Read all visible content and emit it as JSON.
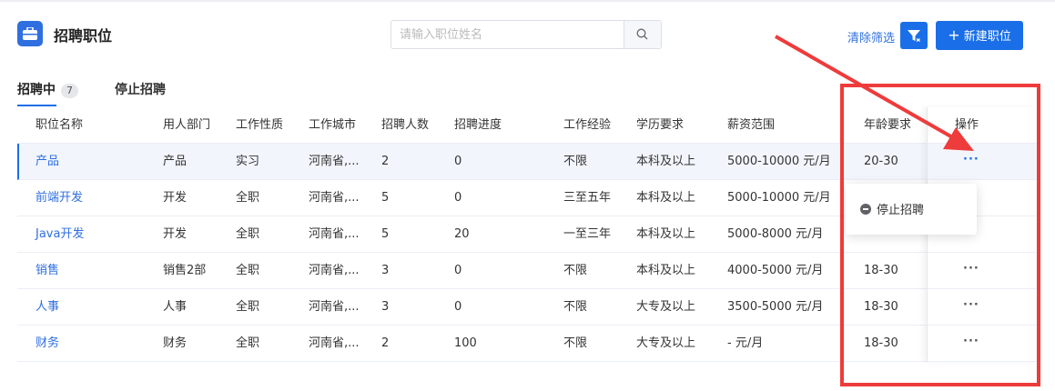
{
  "header": {
    "title": "招聘职位",
    "title_icon": "briefcase-icon",
    "search_placeholder": "请输入职位姓名",
    "search_icon": "search-icon",
    "clear_filters": "清除筛选",
    "filter_icon": "filter-clear-icon",
    "new_button": "新建职位",
    "new_button_icon": "plus-icon"
  },
  "tabs": {
    "recruiting": "招聘中",
    "recruiting_count": "7",
    "stopped": "停止招聘"
  },
  "table": {
    "columns": [
      "职位名称",
      "用人部门",
      "工作性质",
      "工作城市",
      "招聘人数",
      "招聘进度",
      "工作经验",
      "学历要求",
      "薪资范围",
      "年龄要求",
      "操作"
    ],
    "rows": [
      {
        "name": "产品",
        "dept": "产品",
        "type": "实习",
        "city": "河南省,...",
        "count": "2",
        "progress": "0",
        "exp": "不限",
        "edu": "本科及以上",
        "salary": "5000-10000 元/月",
        "age": "20-30",
        "action": "···"
      },
      {
        "name": "前端开发",
        "dept": "开发",
        "type": "全职",
        "city": "河南省,...",
        "count": "5",
        "progress": "0",
        "exp": "三至五年",
        "edu": "本科及以上",
        "salary": "5000-10000 元/月",
        "age": "",
        "action": ""
      },
      {
        "name": "Java开发",
        "dept": "开发",
        "type": "全职",
        "city": "河南省,...",
        "count": "5",
        "progress": "20",
        "exp": "一至三年",
        "edu": "本科及以上",
        "salary": "5000-8000 元/月",
        "age": "",
        "action": ""
      },
      {
        "name": "销售",
        "dept": "销售2部",
        "type": "全职",
        "city": "河南省,...",
        "count": "3",
        "progress": "0",
        "exp": "不限",
        "edu": "本科及以上",
        "salary": "4000-5000 元/月",
        "age": "18-30",
        "action": "···"
      },
      {
        "name": "人事",
        "dept": "人事",
        "type": "全职",
        "city": "河南省,...",
        "count": "3",
        "progress": "0",
        "exp": "不限",
        "edu": "大专及以上",
        "salary": "3500-5000 元/月",
        "age": "18-30",
        "action": "···"
      },
      {
        "name": "财务",
        "dept": "财务",
        "type": "全职",
        "city": "河南省,...",
        "count": "2",
        "progress": "100",
        "exp": "不限",
        "edu": "大专及以上",
        "salary": "- 元/月",
        "age": "18-30",
        "action": "···"
      }
    ]
  },
  "dropdown": {
    "stop_recruit": "停止招聘",
    "stop_icon": "minus-circle-icon"
  },
  "colors": {
    "accent": "#1a6fe8",
    "link": "#2f6fe0",
    "annotation": "#ee3b3b"
  }
}
